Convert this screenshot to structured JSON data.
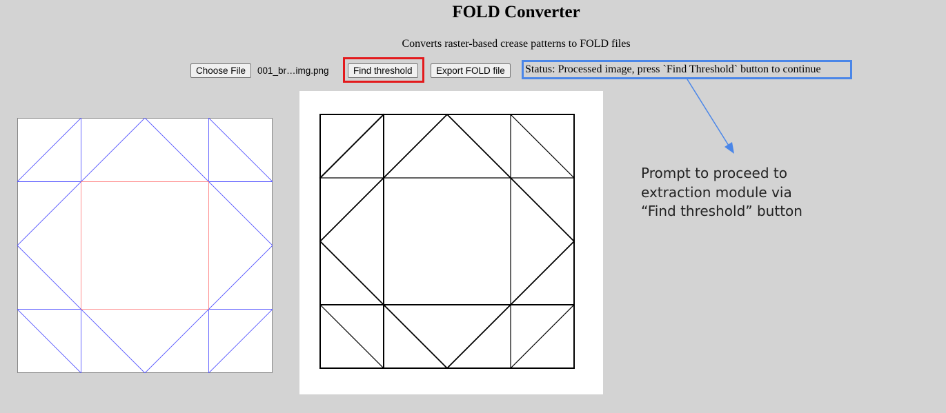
{
  "header": {
    "title": "FOLD Converter",
    "subtitle": "Converts raster-based crease patterns to FOLD files"
  },
  "toolbar": {
    "choose_file_label": "Choose File",
    "file_name": "001_br…img.png",
    "find_threshold_label": "Find threshold",
    "export_label": "Export FOLD file",
    "status_text": "Status: Processed image, press `Find Threshold` button to continue"
  },
  "annotation": {
    "callout_lines": [
      "Prompt to proceed to",
      "extraction module via",
      "“Find threshold” button"
    ]
  },
  "colors": {
    "background": "#d3d3d3",
    "red_highlight": "#e3191c",
    "blue_highlight": "#4a86e8",
    "valley_line": "#5555ff",
    "mountain_line": "#ff8080"
  },
  "panels": {
    "left": "crease-pattern-preview",
    "right": "source-raster-image"
  }
}
